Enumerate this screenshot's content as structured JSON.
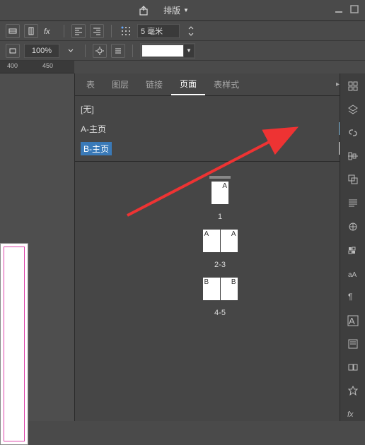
{
  "menubar": {
    "layout_label": "排版"
  },
  "toolbar1": {
    "size_value": "5 毫米"
  },
  "toolbar2": {
    "opacity_value": "100%"
  },
  "ruler": {
    "marks": [
      "400",
      "450"
    ]
  },
  "panel": {
    "tabs": [
      "表",
      "图层",
      "链接",
      "页面",
      "表样式"
    ],
    "active_tab_index": 3
  },
  "masters": {
    "none_label": "[无]",
    "a_label": "A-主页",
    "b_label": "B-主页"
  },
  "pages": {
    "page1_letter": "A",
    "page1_num": "1",
    "spread23_left": "A",
    "spread23_right": "A",
    "spread23_num": "2-3",
    "spread45_left": "B",
    "spread45_right": "B",
    "spread45_num": "4-5"
  }
}
